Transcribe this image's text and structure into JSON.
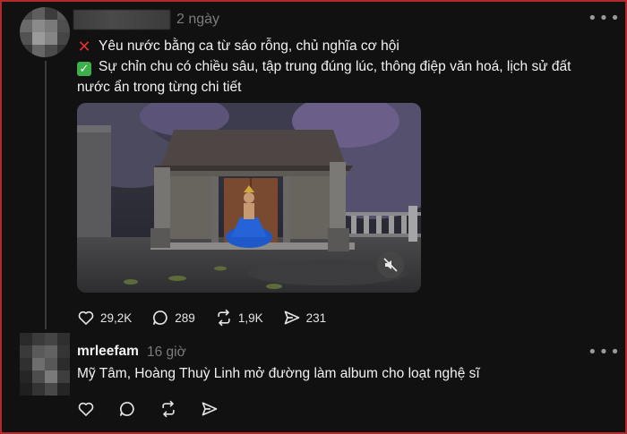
{
  "post": {
    "time": "2 ngày",
    "line1": "Yêu nước bằng ca từ sáo rỗng, chủ nghĩa cơ hội",
    "line2": "Sự chỉn chu có chiều sâu, tập trung đúng lúc, thông điệp văn hoá, lịch sử đất",
    "line3": "nước ẩn trong từng chi tiết",
    "likes": "29,2K",
    "comments": "289",
    "reposts": "1,9K",
    "shares": "231"
  },
  "reply": {
    "username": "mrleefam",
    "time": "16 giờ",
    "text": "Mỹ Tâm, Hoàng Thuỳ Linh mở đường làm album cho loạt nghệ sĩ"
  },
  "colors": {
    "background": "#111111",
    "border": "#b22a2a",
    "text": "#f2f2f2",
    "muted": "#7c7c7c"
  }
}
